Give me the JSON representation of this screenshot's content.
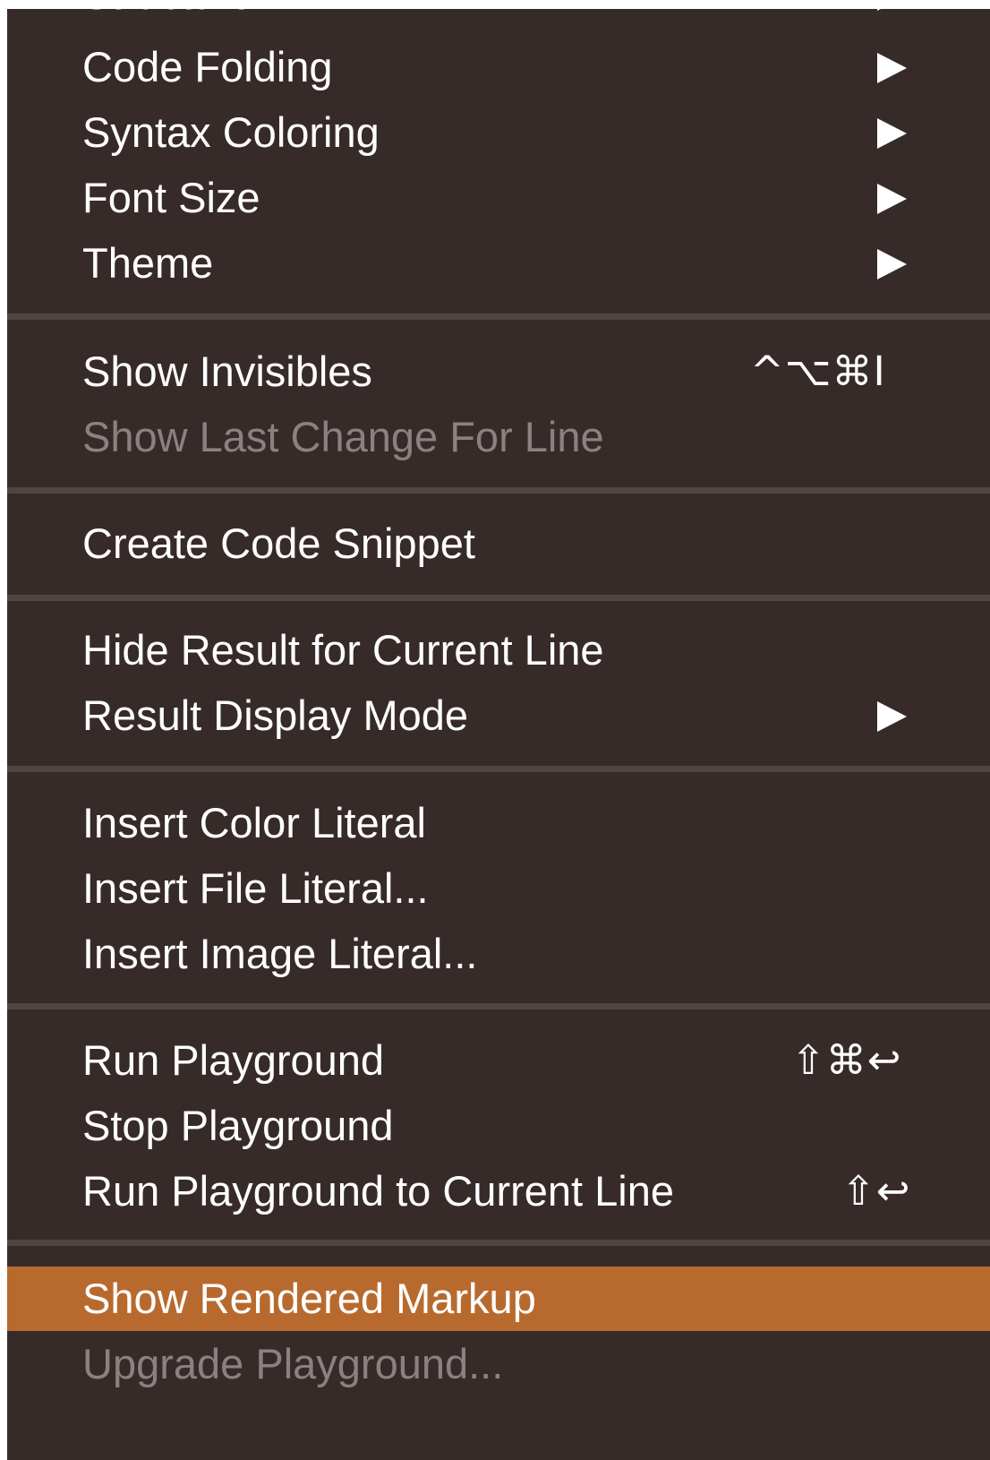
{
  "menu": {
    "top_partial": {
      "label": "Structure"
    },
    "code_folding": {
      "label": "Code Folding"
    },
    "syntax_coloring": {
      "label": "Syntax Coloring"
    },
    "font_size": {
      "label": "Font Size"
    },
    "theme": {
      "label": "Theme"
    },
    "show_invisibles": {
      "label": "Show Invisibles",
      "shortcut": "^⌥⌘I"
    },
    "show_last_change": {
      "label": "Show Last Change For Line"
    },
    "create_code_snippet": {
      "label": "Create Code Snippet"
    },
    "hide_result": {
      "label": "Hide Result for Current Line"
    },
    "result_display_mode": {
      "label": "Result Display Mode"
    },
    "insert_color_literal": {
      "label": "Insert Color Literal"
    },
    "insert_file_literal": {
      "label": "Insert File Literal..."
    },
    "insert_image_literal": {
      "label": "Insert Image Literal..."
    },
    "run_playground": {
      "label": "Run Playground",
      "shortcut": "⇧⌘↩"
    },
    "stop_playground": {
      "label": "Stop Playground"
    },
    "run_to_current_line": {
      "label": "Run Playground to Current Line",
      "shortcut": "⇧↩"
    },
    "show_rendered_markup": {
      "label": "Show Rendered Markup"
    },
    "upgrade_playground": {
      "label": "Upgrade Playground..."
    }
  },
  "colors": {
    "menu_background": "#372b29",
    "separator": "#4f4644",
    "highlight": "#b86a2e",
    "text": "#ffffff",
    "disabled_text": "#8a8280"
  },
  "icons": {
    "submenu": "submenu-arrow-icon"
  }
}
